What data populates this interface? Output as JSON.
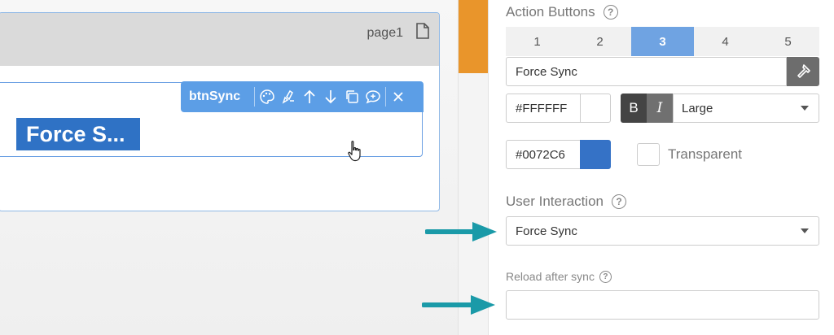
{
  "canvas": {
    "page_name": "page1",
    "widget": {
      "id": "btnSync",
      "preview_label": "Force S...",
      "preview_color": "#2f72c5",
      "toolbar_icons": [
        "palette-icon",
        "paint-brush-icon",
        "arrow-up-icon",
        "arrow-down-icon",
        "copy-icon",
        "comment-plus-icon",
        "close-icon"
      ]
    }
  },
  "accent_color": "#e9952b",
  "props": {
    "action_buttons": {
      "title": "Action Buttons",
      "tabs": [
        "1",
        "2",
        "3",
        "4",
        "5"
      ],
      "active_tab": "3",
      "label_value": "Force Sync",
      "text_color": "#FFFFFF",
      "bold_label": "B",
      "italic_label": "I",
      "size_value": "Large",
      "bg_color": "#0072C6",
      "bg_swatch": "#3572c6",
      "transparent_label": "Transparent"
    },
    "user_interaction": {
      "title": "User Interaction",
      "value": "Force Sync"
    },
    "reload_after_sync": {
      "label": "Reload after sync",
      "value": ""
    },
    "help_glyph": "?"
  },
  "annotation_arrow_color": "#1a9aa8"
}
